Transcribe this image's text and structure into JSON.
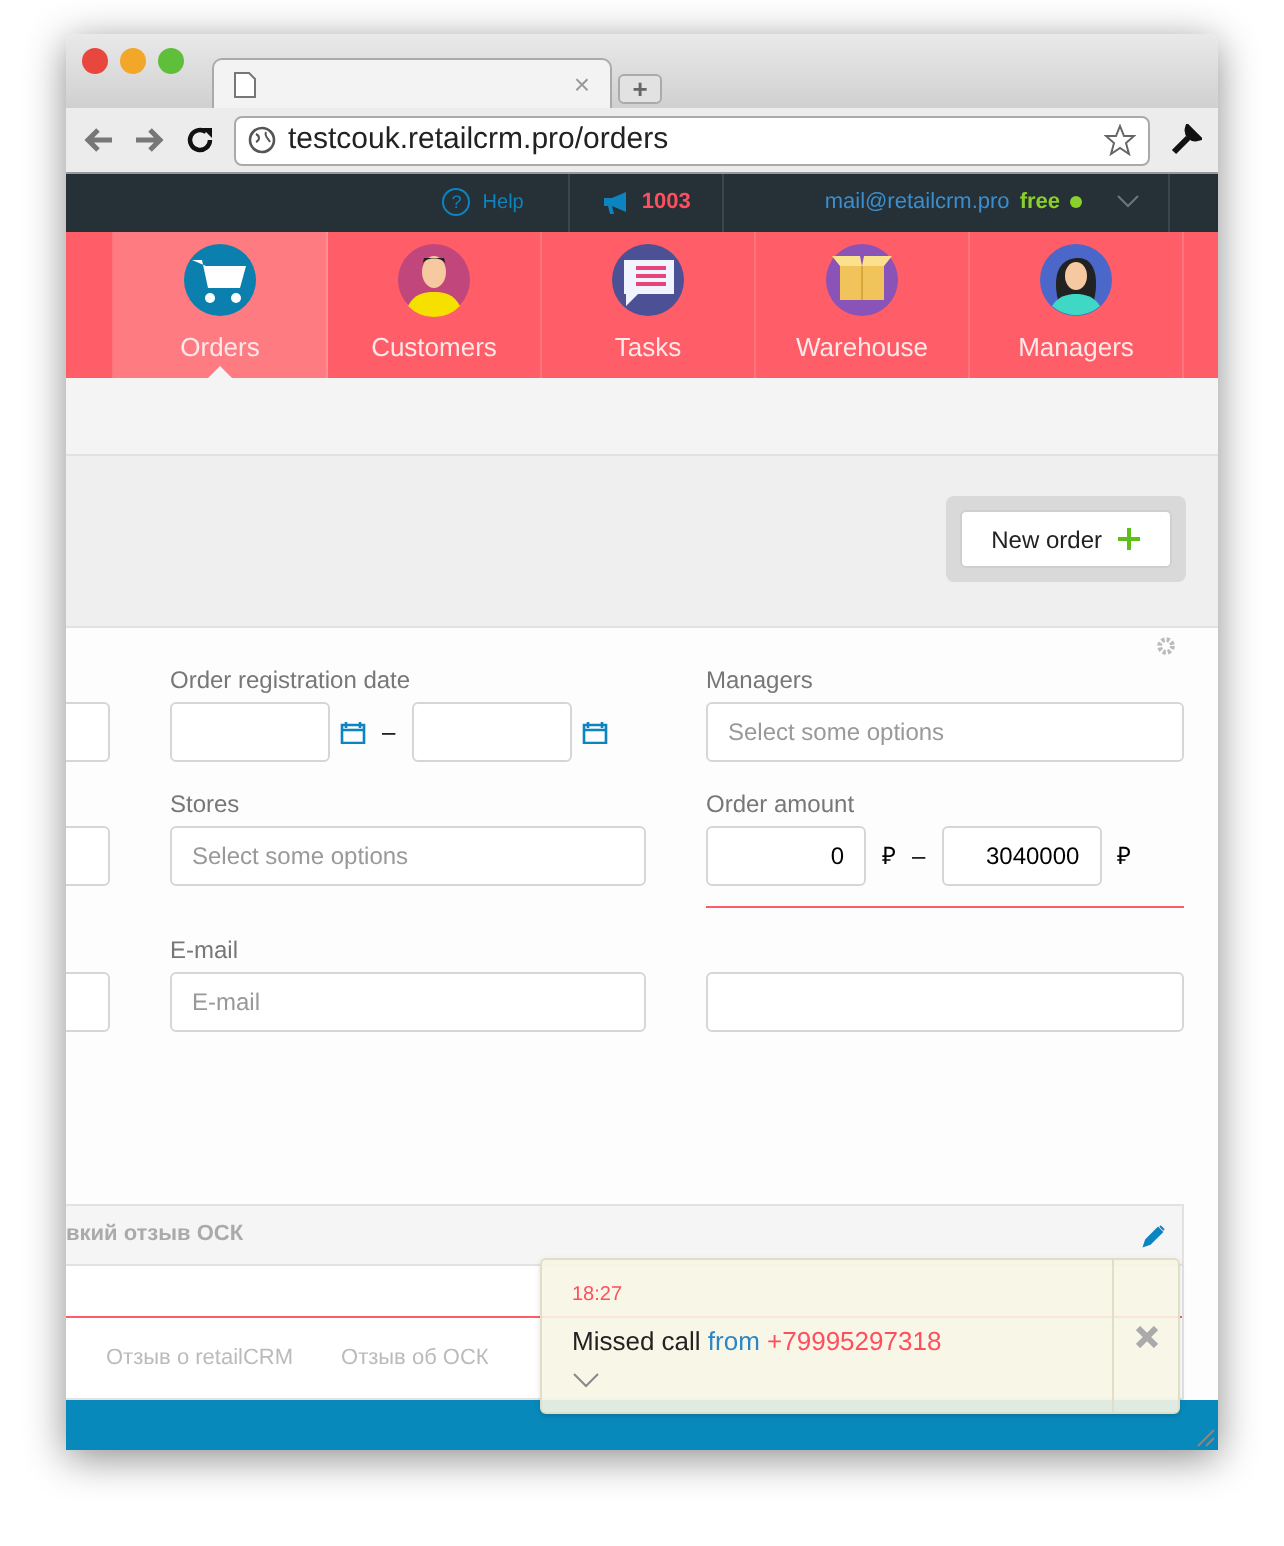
{
  "browser": {
    "tab_close": "×",
    "new_tab": "+",
    "url": "testcouk.retailcrm.pro/orders"
  },
  "topbar": {
    "help_icon": "?",
    "help": "Help",
    "notifications_count": "1003",
    "email": "mail@retailcrm.pro",
    "plan": "free"
  },
  "nav": [
    {
      "label": "Orders",
      "kind": "cart",
      "selected": true
    },
    {
      "label": "Customers",
      "kind": "person",
      "selected": false
    },
    {
      "label": "Tasks",
      "kind": "chat",
      "selected": false
    },
    {
      "label": "Warehouse",
      "kind": "box",
      "selected": false
    },
    {
      "label": "Managers",
      "kind": "woman",
      "selected": false
    }
  ],
  "actions": {
    "new_order": "New order"
  },
  "filters": {
    "date": {
      "label": "Order registration date",
      "dash": "–"
    },
    "managers": {
      "label": "Managers",
      "placeholder": "Select some options"
    },
    "stores": {
      "label": "Stores",
      "placeholder": "Select some options"
    },
    "amount": {
      "label": "Order amount",
      "from": "0",
      "to": "3040000",
      "currency": "₽",
      "dash": "–"
    },
    "email": {
      "label": "E-mail",
      "placeholder": "E-mail"
    }
  },
  "panel": {
    "title": "вкий отзыв ОСК",
    "links": [
      "Отзыв о retailCRM",
      "Отзыв об ОСК"
    ]
  },
  "notification": {
    "time": "18:27",
    "message": "Missed call",
    "from": "from",
    "phone": "+79995297318"
  }
}
